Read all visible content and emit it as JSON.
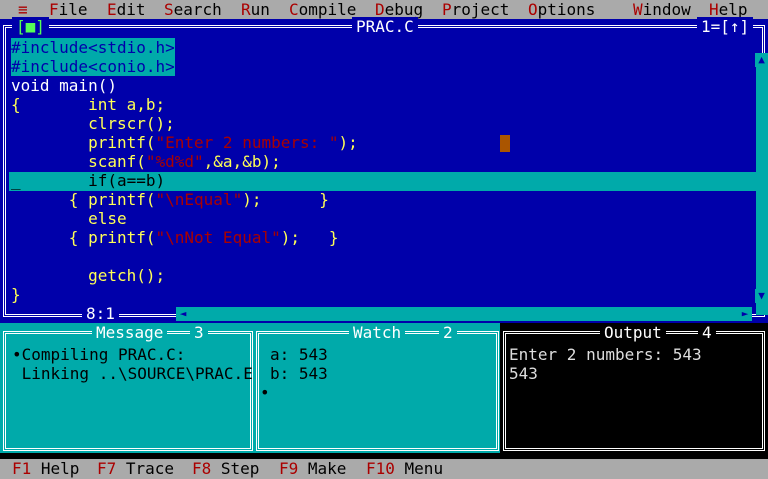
{
  "menu": {
    "system": "≡",
    "items": [
      {
        "hot": "F",
        "rest": "ile"
      },
      {
        "hot": "E",
        "rest": "dit"
      },
      {
        "hot": "S",
        "rest": "earch"
      },
      {
        "hot": "R",
        "rest": "un"
      },
      {
        "hot": "C",
        "rest": "ompile"
      },
      {
        "hot": "D",
        "rest": "ebug"
      },
      {
        "hot": "P",
        "rest": "roject"
      },
      {
        "hot": "O",
        "rest": "ptions"
      },
      {
        "hot": "W",
        "rest": "indow"
      },
      {
        "hot": "H",
        "rest": "elp"
      }
    ]
  },
  "editor": {
    "close_box": "[■]",
    "title": "PRAC.C",
    "window_num": "1=[↑]",
    "lines": [
      {
        "a": "#include<stdio.h>",
        "b": "",
        "c": ""
      },
      {
        "a": "#include<conio.h>",
        "b": "",
        "c": ""
      },
      {
        "a": "void main()",
        "b": "",
        "c": ""
      },
      {
        "a": "{       int a,b;",
        "b": "",
        "c": ""
      },
      {
        "a": "        clrscr();",
        "b": "",
        "c": ""
      },
      {
        "a": "        printf(",
        "b": "\"Enter 2 numbers: \"",
        "c": ");"
      },
      {
        "a": "        scanf(",
        "b": "\"%d%d\"",
        "c": ",&a,&b);"
      },
      {
        "a": "        if(a==b)",
        "b": "",
        "c": ""
      },
      {
        "a": "      { printf(",
        "b": "\"\\nEqual\"",
        "c": ");      }"
      },
      {
        "a": "        else",
        "b": "",
        "c": ""
      },
      {
        "a": "      { printf(",
        "b": "\"\\nNot Equal\"",
        "c": ");   }"
      },
      {
        "a": "",
        "b": "",
        "c": ""
      },
      {
        "a": "        getch();",
        "b": "",
        "c": ""
      },
      {
        "a": "}",
        "b": "",
        "c": ""
      }
    ],
    "cursor_marker": "_",
    "position": "8:1"
  },
  "message": {
    "title": "Message",
    "num": "3",
    "lines": [
      "•Compiling PRAC.C:",
      " Linking ..\\SOURCE\\PRAC.E"
    ]
  },
  "watch": {
    "title": "Watch",
    "num": "2",
    "lines": [
      "a: 543",
      "b: 543",
      "•"
    ]
  },
  "output": {
    "title": "Output",
    "num": "4",
    "lines": [
      "Enter 2 numbers: 543",
      "543"
    ]
  },
  "status": {
    "keys": [
      {
        "key": "F1",
        "label": " Help"
      },
      {
        "key": "F7",
        "label": " Trace"
      },
      {
        "key": "F8",
        "label": " Step"
      },
      {
        "key": "F9",
        "label": " Make"
      },
      {
        "key": "F10",
        "label": " Menu"
      }
    ]
  },
  "colors": {
    "editor_bg": "#0000aa",
    "highlight": "#00aaaa",
    "menu_bg": "#aaaaaa",
    "hotkey": "#aa0000",
    "code_text": "#ffff55",
    "string_text": "#aa0000"
  }
}
